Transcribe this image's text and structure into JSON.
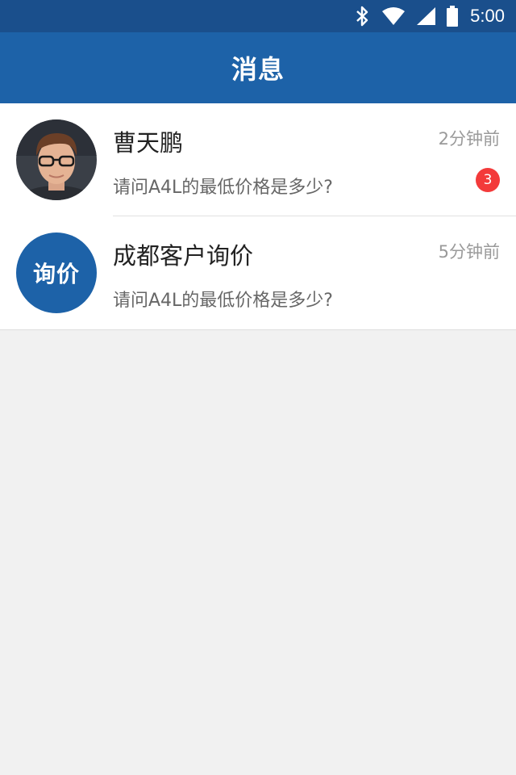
{
  "status_bar": {
    "time": "5:00",
    "icons": [
      "bluetooth-icon",
      "wifi-icon",
      "signal-icon",
      "battery-icon"
    ]
  },
  "header": {
    "title": "消息"
  },
  "conversations": [
    {
      "name": "曹天鹏",
      "time": "2分钟前",
      "preview": "请问A4L的最低价格是多少?",
      "unread": "3",
      "avatar": "user-photo"
    },
    {
      "name": "成都客户询价",
      "time": "5分钟前",
      "preview": "请问A4L的最低价格是多少?",
      "avatar_text": "询价"
    }
  ],
  "colors": {
    "status_bar": "#1a4f8c",
    "app_bar": "#1d62a8",
    "badge": "#f33a3a",
    "background": "#f1f1f1"
  }
}
